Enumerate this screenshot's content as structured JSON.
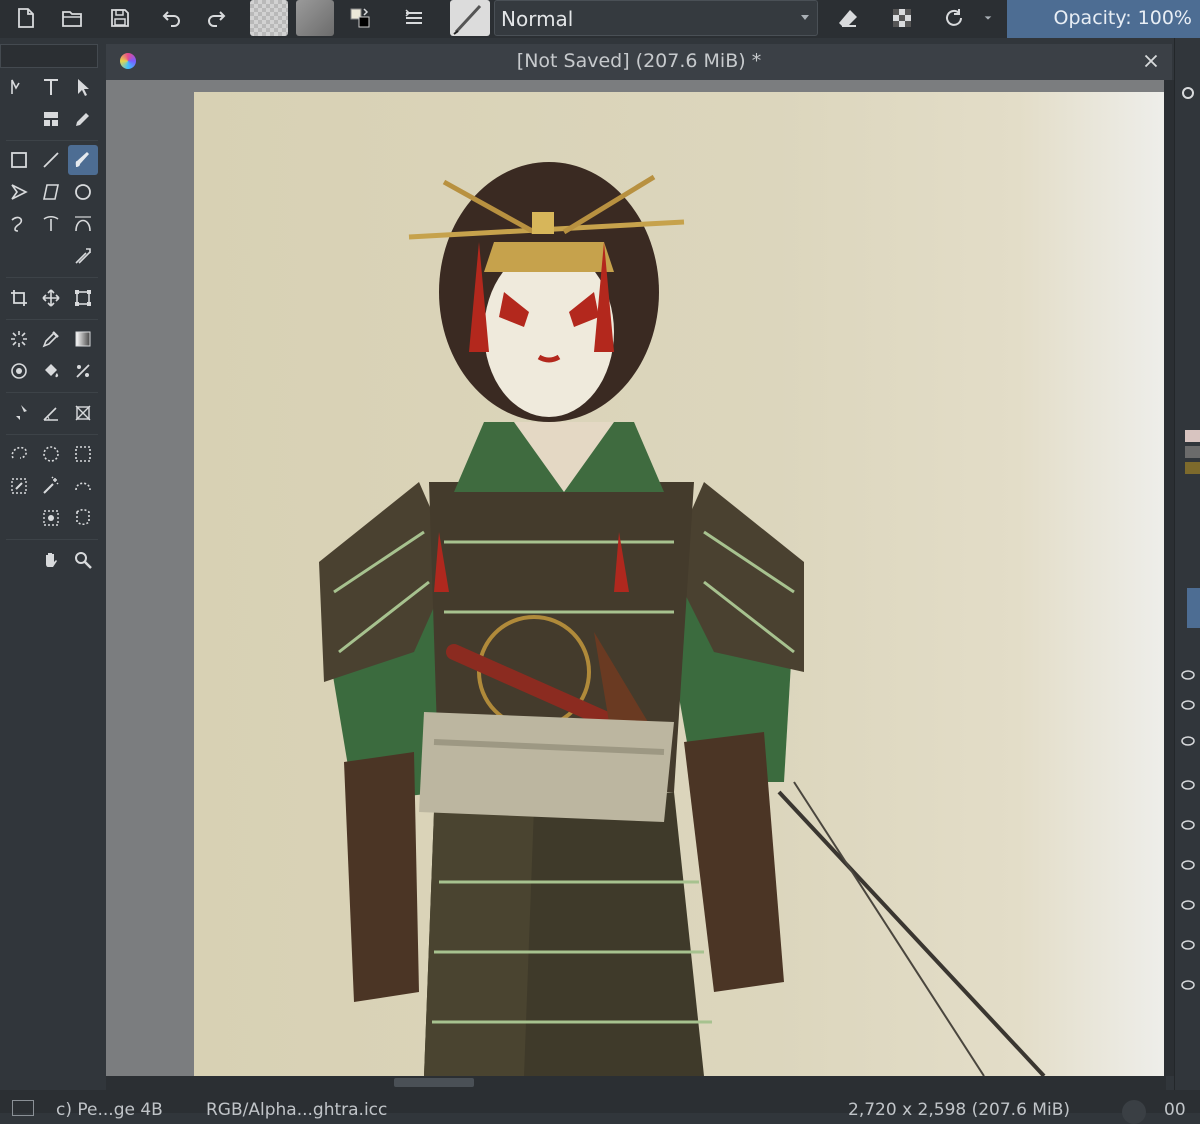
{
  "toolbar": {
    "blend_mode": "Normal",
    "opacity_label": "Opacity: 100%",
    "icons": [
      "new-document-icon",
      "open-folder-icon",
      "save-icon",
      "undo-icon",
      "redo-icon",
      "gradient-swatch",
      "pattern-swatch",
      "color-swap-icon",
      "brush-presets-icon",
      "brush-preview",
      "eraser-icon",
      "alpha-lock-icon",
      "reload-icon"
    ]
  },
  "document": {
    "title": "[Not Saved]  (207.6 MiB) *"
  },
  "toolbox": {
    "active_tool": "freehand-brush-tool"
  },
  "status": {
    "brush_label": "c) Pe...ge 4B",
    "color_space": "RGB/Alpha...ghtra.icc",
    "image_size": "2,720 x 2,598 (207.6 MiB)",
    "zoom_fragment": "00"
  },
  "canvas": {
    "background_color": "#d8d1b4",
    "content": "digital painting of a warrior in armor"
  }
}
